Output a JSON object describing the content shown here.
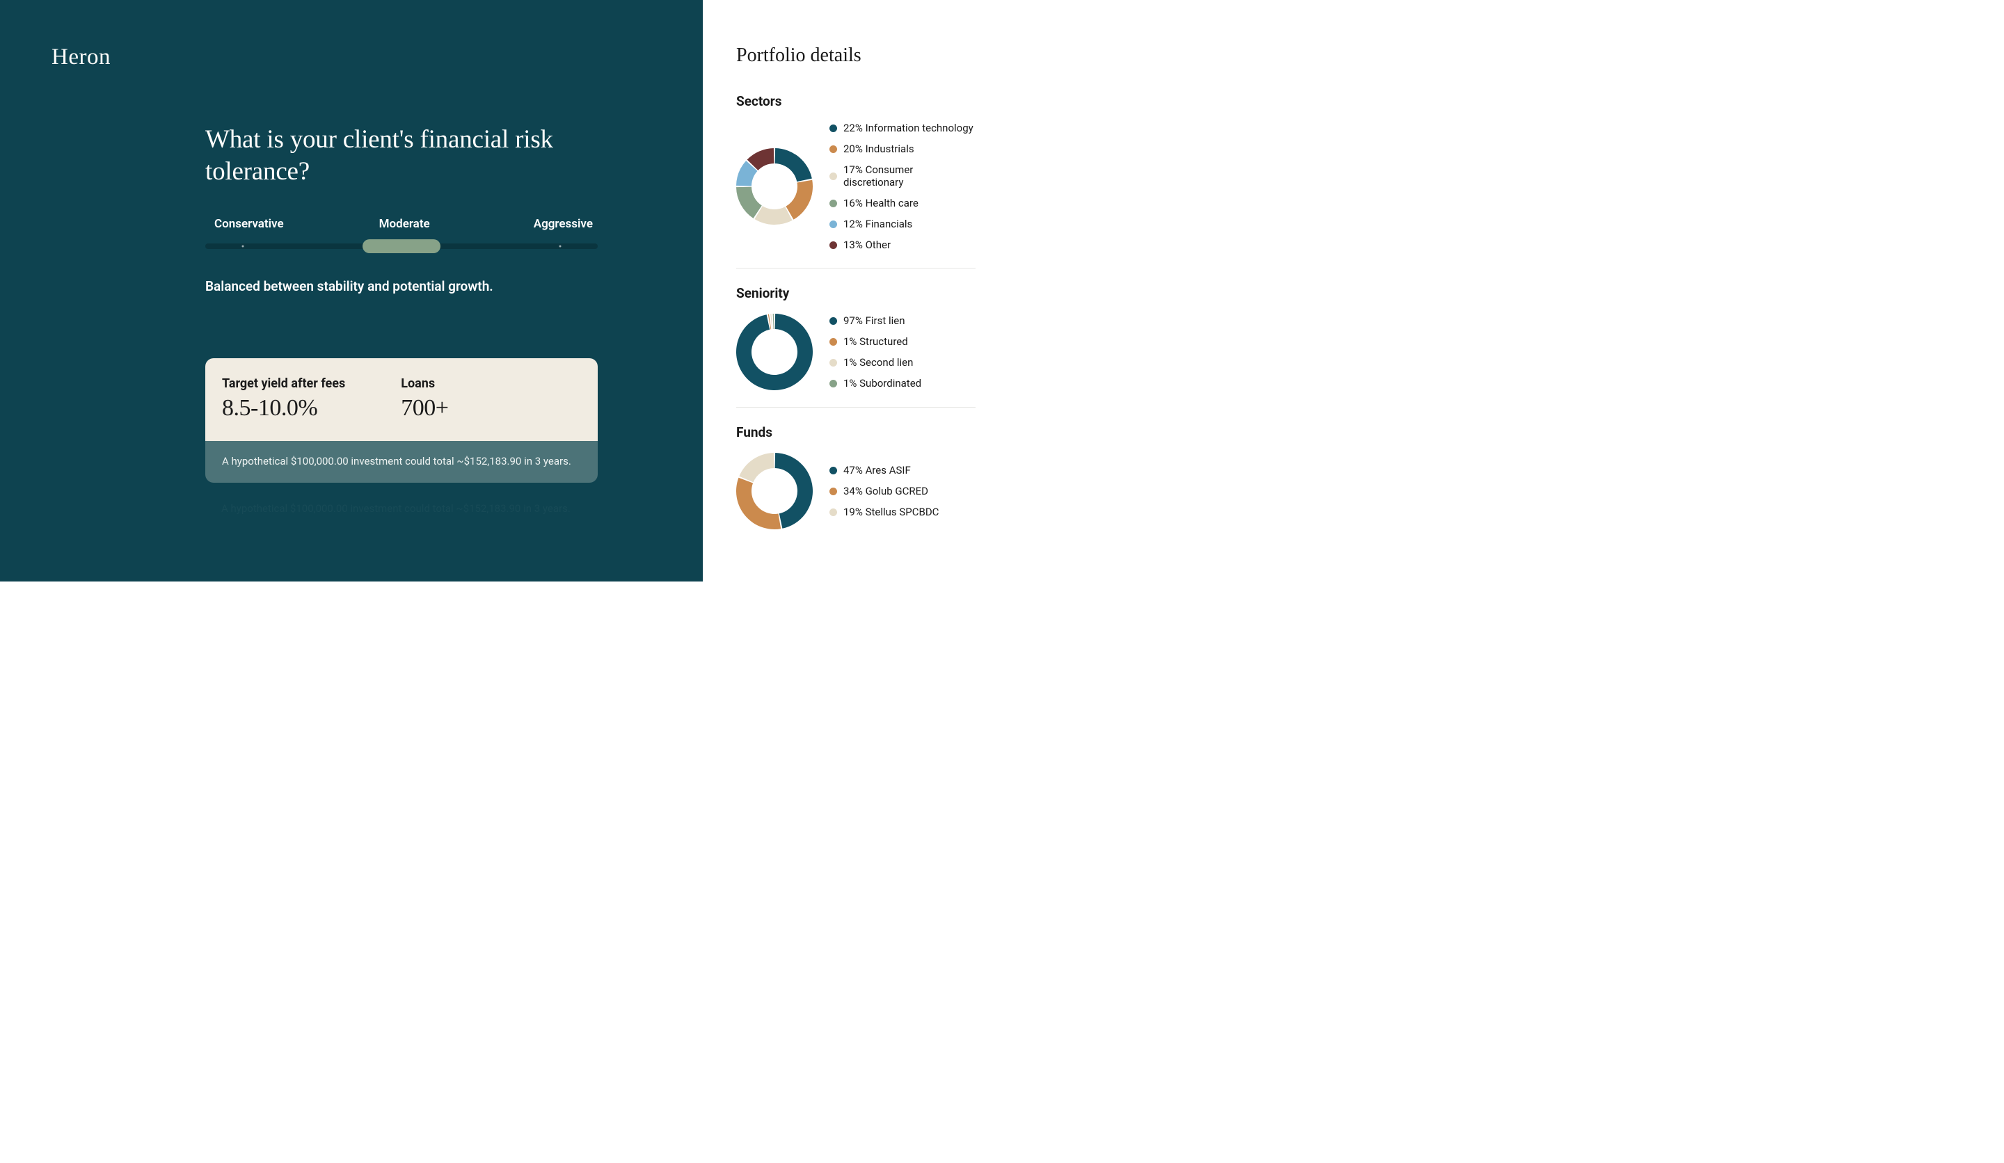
{
  "logo": "Heron",
  "question": "What is your client's financial risk tolerance?",
  "slider": {
    "labels": [
      "Conservative",
      "Moderate",
      "Aggressive"
    ],
    "selected_index": 1,
    "description": "Balanced between stability and potential growth."
  },
  "stats": {
    "yield_label": "Target yield after fees",
    "yield_value": "8.5-10.0%",
    "loans_label": "Loans",
    "loans_value": "700+",
    "hypothesis": "A hypothetical $100,000.00 investment could total ~$152,183.90 in 3 years."
  },
  "ghost": "A hypothetical $100,000.00 investment could total ~$152,183.90 in 3 years.",
  "panel": {
    "title": "Portfolio details"
  },
  "chart_data": [
    {
      "id": "sectors",
      "title": "Sectors",
      "type": "pie",
      "series": [
        {
          "name": "Information technology",
          "value": 22,
          "color": "#125164"
        },
        {
          "name": "Industrials",
          "value": 20,
          "color": "#cb8a4d"
        },
        {
          "name": "Consumer discretionary",
          "value": 17,
          "color": "#e5dcc8"
        },
        {
          "name": "Health care",
          "value": 16,
          "color": "#87a288"
        },
        {
          "name": "Financials",
          "value": 12,
          "color": "#7ab3d6"
        },
        {
          "name": "Other",
          "value": 13,
          "color": "#6e3434"
        }
      ]
    },
    {
      "id": "seniority",
      "title": "Seniority",
      "type": "pie",
      "series": [
        {
          "name": "First lien",
          "value": 97,
          "color": "#125164"
        },
        {
          "name": "Structured",
          "value": 1,
          "color": "#cb8a4d"
        },
        {
          "name": "Second lien",
          "value": 1,
          "color": "#e5dcc8"
        },
        {
          "name": "Subordinated",
          "value": 1,
          "color": "#87a288"
        }
      ]
    },
    {
      "id": "funds",
      "title": "Funds",
      "type": "pie",
      "series": [
        {
          "name": "Ares ASIF",
          "value": 47,
          "color": "#125164"
        },
        {
          "name": "Golub GCRED",
          "value": 34,
          "color": "#cb8a4d"
        },
        {
          "name": "Stellus SPCBDC",
          "value": 19,
          "color": "#e5dcc8"
        }
      ]
    }
  ]
}
